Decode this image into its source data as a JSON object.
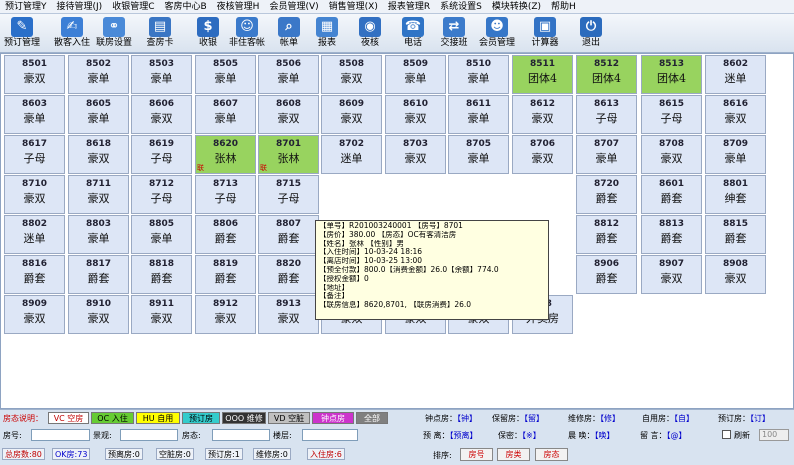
{
  "menu": [
    {
      "label": "预订管理Y"
    },
    {
      "label": "接待管理(J)"
    },
    {
      "label": "收银管理C"
    },
    {
      "label": "客房中心B"
    },
    {
      "label": "夜核管理H"
    },
    {
      "label": "会员管理(V)"
    },
    {
      "label": "销售管理(X)"
    },
    {
      "label": "报表管理R"
    },
    {
      "label": "系统设置S"
    },
    {
      "label": "模块转换(Z)"
    },
    {
      "label": "帮助H"
    }
  ],
  "toolbar": [
    {
      "label": "预订管理",
      "icon": "booking-icon",
      "color": "#2a6fc9",
      "glyph": "✎"
    },
    {
      "label": "散客入住",
      "icon": "checkin-icon",
      "color": "#3c7fd6",
      "glyph": "✍"
    },
    {
      "label": "联房设置",
      "icon": "link-rooms-icon",
      "color": "#4a8ad8",
      "glyph": "⚭"
    },
    {
      "label": "查房卡",
      "icon": "room-card-icon",
      "color": "#3a76c4",
      "glyph": "▤"
    },
    {
      "label": "收银",
      "icon": "cashier-icon",
      "color": "#2d6cc0",
      "glyph": "$"
    },
    {
      "label": "非住客帐",
      "icon": "guest-account-icon",
      "color": "#3a7acb",
      "glyph": "☺"
    },
    {
      "label": "帐单",
      "icon": "bill-search-icon",
      "color": "#3b78c8",
      "glyph": "⌕"
    },
    {
      "label": "报表",
      "icon": "report-icon",
      "color": "#4484d1",
      "glyph": "▦"
    },
    {
      "label": "夜核",
      "icon": "night-audit-icon",
      "color": "#3270c2",
      "glyph": "◉"
    },
    {
      "label": "电话",
      "icon": "phone-icon",
      "color": "#2f74c6",
      "glyph": "☎"
    },
    {
      "label": "交接班",
      "icon": "shift-handover-icon",
      "color": "#3c7bcb",
      "glyph": "⇄"
    },
    {
      "label": "会员管理",
      "icon": "member-icon",
      "color": "#3677c8",
      "glyph": "☻"
    },
    {
      "label": "计算器",
      "icon": "calculator-icon",
      "color": "#3373c5",
      "glyph": "▣"
    },
    {
      "label": "退出",
      "icon": "power-icon",
      "color": "#2b6bbd",
      "glyph": "⏻"
    }
  ],
  "rooms": [
    {
      "no": "8501",
      "type": "豪双"
    },
    {
      "no": "8502",
      "type": "豪单"
    },
    {
      "no": "8503",
      "type": "豪单"
    },
    {
      "no": "8505",
      "type": "豪单"
    },
    {
      "no": "8506",
      "type": "豪单"
    },
    {
      "no": "8508",
      "type": "豪双"
    },
    {
      "no": "8509",
      "type": "豪单"
    },
    {
      "no": "8510",
      "type": "豪单"
    },
    {
      "no": "8511",
      "type": "团体4",
      "status": "occupied"
    },
    {
      "no": "8512",
      "type": "团体4",
      "status": "occupied"
    },
    {
      "no": "8513",
      "type": "团体4",
      "status": "occupied"
    },
    {
      "no": "8602",
      "type": "迷单"
    },
    {
      "no": "8603",
      "type": "豪单"
    },
    {
      "no": "8605",
      "type": "豪单"
    },
    {
      "no": "8606",
      "type": "豪双"
    },
    {
      "no": "8607",
      "type": "豪单"
    },
    {
      "no": "8608",
      "type": "豪双"
    },
    {
      "no": "8609",
      "type": "豪双"
    },
    {
      "no": "8610",
      "type": "豪双"
    },
    {
      "no": "8611",
      "type": "豪单"
    },
    {
      "no": "8612",
      "type": "豪双"
    },
    {
      "no": "8613",
      "type": "子母"
    },
    {
      "no": "8615",
      "type": "子母"
    },
    {
      "no": "8616",
      "type": "豪双"
    },
    {
      "no": "8617",
      "type": "子母"
    },
    {
      "no": "8618",
      "type": "豪双"
    },
    {
      "no": "8619",
      "type": "子母"
    },
    {
      "no": "8620",
      "type": "张林",
      "status": "occupied",
      "mark": "联"
    },
    {
      "no": "8701",
      "type": "张林",
      "status": "occupied",
      "mark": "联"
    },
    {
      "no": "8702",
      "type": "迷单"
    },
    {
      "no": "8703",
      "type": "豪双"
    },
    {
      "no": "8705",
      "type": "豪单"
    },
    {
      "no": "8706",
      "type": "豪双"
    },
    {
      "no": "8707",
      "type": "豪单"
    },
    {
      "no": "8708",
      "type": "豪双"
    },
    {
      "no": "8709",
      "type": "豪单"
    },
    {
      "no": "8710",
      "type": "豪双"
    },
    {
      "no": "8711",
      "type": "豪双"
    },
    {
      "no": "8712",
      "type": "子母"
    },
    {
      "no": "8713",
      "type": "子母"
    },
    {
      "no": "8715",
      "type": "子母"
    },
    {
      "no": "8720",
      "type": "爵套"
    },
    {
      "no": "8601",
      "type": "爵套"
    },
    {
      "no": "8801",
      "type": "绅套"
    },
    {
      "no": "8802",
      "type": "迷单"
    },
    {
      "no": "8803",
      "type": "豪单"
    },
    {
      "no": "8805",
      "type": "豪单"
    },
    {
      "no": "8806",
      "type": "爵套"
    },
    {
      "no": "8807",
      "type": "爵套"
    },
    {
      "no": "8812",
      "type": "爵套"
    },
    {
      "no": "8813",
      "type": "爵套"
    },
    {
      "no": "8815",
      "type": "爵套"
    },
    {
      "no": "8816",
      "type": "爵套"
    },
    {
      "no": "8817",
      "type": "爵套"
    },
    {
      "no": "8818",
      "type": "爵套"
    },
    {
      "no": "8819",
      "type": "爵套"
    },
    {
      "no": "8820",
      "type": "爵套"
    },
    {
      "no": "8906",
      "type": "爵套"
    },
    {
      "no": "8907",
      "type": "豪双"
    },
    {
      "no": "8908",
      "type": "豪双"
    },
    {
      "no": "8909",
      "type": "豪双"
    },
    {
      "no": "8910",
      "type": "豪双"
    },
    {
      "no": "8911",
      "type": "豪双"
    },
    {
      "no": "8912",
      "type": "豪双"
    },
    {
      "no": "8913",
      "type": "豪双"
    },
    {
      "no": "8915",
      "type": "豪双"
    },
    {
      "no": "8916",
      "type": "豪双"
    },
    {
      "no": "8918",
      "type": "豪双"
    },
    {
      "no": "888",
      "type": "外卖房"
    }
  ],
  "tooltip": [
    "【单号】R201003240001 【房号】8701",
    "【房价】380.00 【房态】OC有客清洁房",
    "【姓名】张林 【性别】男",
    "【入住时间】10-03-24 18:16",
    "【离店时间】10-03-25 13:00",
    "【预全付款】800.0【消费金额】26.0【余额】774.0",
    "【授权金额】0",
    "【地址】",
    "【备注】",
    "【联房信息】8620,8701, 【联房消费】26.0"
  ],
  "legend": {
    "title": "房态说明：",
    "items": [
      {
        "label": "VC 空房",
        "bg": "#ffffff",
        "fg": "#c00000"
      },
      {
        "label": "OC 入住",
        "bg": "#66cc33",
        "fg": "#000000"
      },
      {
        "label": "HU 自用",
        "bg": "#ffff00",
        "fg": "#000000"
      },
      {
        "label": "预订房",
        "bg": "#33cccc",
        "fg": "#000000"
      },
      {
        "label": "OOO 维修",
        "bg": "#333333",
        "fg": "#ffffff"
      },
      {
        "label": "VD 空脏",
        "bg": "#c0c0c0",
        "fg": "#000000"
      },
      {
        "label": "钟点房",
        "bg": "#cc33cc",
        "fg": "#ffffff"
      },
      {
        "label": "全部",
        "bg": "#808080",
        "fg": "#ffffff"
      }
    ],
    "hints": [
      {
        "label": "钟点房：",
        "key": "【钟】"
      },
      {
        "label": "保留房：",
        "key": "【留】"
      },
      {
        "label": "维修房：",
        "key": "【修】"
      },
      {
        "label": "自用房：",
        "key": "【自】"
      },
      {
        "label": "预订房：",
        "key": "【订】"
      }
    ]
  },
  "filters": {
    "room_label": "房号:",
    "view_label": "景观:",
    "state_label": "房态:",
    "floor_label": "楼层:",
    "hints": [
      {
        "label": "预  离：",
        "key": "【预离】"
      },
      {
        "label": "保密：",
        "key": "【※】"
      },
      {
        "label": "晨  唤：",
        "key": "【唤】"
      },
      {
        "label": "留  言：",
        "key": "【@】"
      }
    ],
    "refresh_label": "刷新",
    "refresh_value": "100"
  },
  "counts": [
    {
      "label": "总房数:80",
      "color": "#c00000"
    },
    {
      "label": "OK房:73",
      "color": "#0000cc"
    },
    {
      "label": "预离房:0",
      "color": "#000000"
    },
    {
      "label": "空脏房:0",
      "color": "#000000"
    },
    {
      "label": "预订房:1",
      "color": "#000000"
    },
    {
      "label": "维修房:0",
      "color": "#000000"
    },
    {
      "label": "入住房:6",
      "color": "#c00000"
    }
  ],
  "sort": {
    "label": "排序:",
    "buttons": [
      "房号",
      "房类",
      "房态"
    ]
  }
}
